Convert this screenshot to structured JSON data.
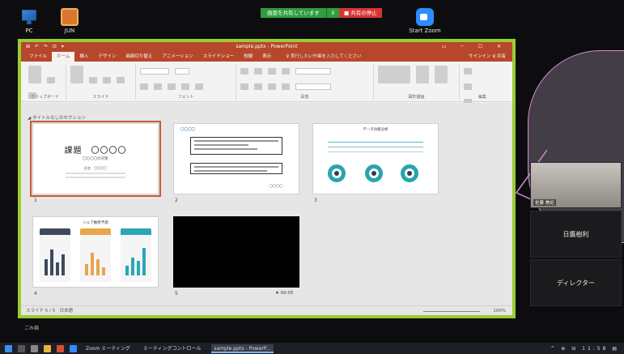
{
  "desktop": {
    "icons": [
      {
        "label": "PC"
      },
      {
        "label": "JUN"
      },
      {
        "label": "Start Zoom"
      }
    ],
    "bottom_note": "ごみ箱"
  },
  "zoom_share_bar": {
    "sharing_label": "画面を共有しています",
    "pause_label": "Ⅱ",
    "stop_label": "■ 共有の停止"
  },
  "powerpoint": {
    "quick_access": "⊞ ↶ ↷ ⊡ ▾",
    "window_title": "sample.pptx - PowerPoint",
    "window_controls": "▭ ─ ☐ ✕",
    "tabs": [
      "ファイル",
      "ホーム",
      "挿入",
      "デザイン",
      "画面切り替え",
      "アニメーション",
      "スライドショー",
      "校閲",
      "表示"
    ],
    "active_tab": "ホーム",
    "tell_me": "♀ 実行したい作業を入力してください",
    "account": "サインイン  ♀ 共有",
    "ribbon_groups": [
      "クリップボード",
      "スライド",
      "フォント",
      "段落",
      "図形描画",
      "編集"
    ],
    "section_name": "◢ タイトルなしのセクション",
    "slides": [
      {
        "number": "1",
        "title": "課題　〇〇〇〇",
        "subtitle": "〇〇〇〇の対策",
        "presenter": "氏名　〇〇〇〇"
      },
      {
        "number": "2",
        "heading": "〇〇〇〇",
        "footer": "〇〇〇〇"
      },
      {
        "number": "3",
        "title": "データ比較分析"
      },
      {
        "number": "4",
        "title": "シェア推移予測"
      },
      {
        "number": "5",
        "duration": "★ 00:05"
      }
    ],
    "status_left": "スライド 5 / 5　日本語",
    "zoom_level": "100%"
  },
  "participants": {
    "video_name": "佐藤 美紀",
    "tiles": [
      "日鷹樹利",
      "ディレクター"
    ]
  },
  "taskbar": {
    "items": [
      "Zoom ミーティング",
      "ミーティングコントロール",
      "sample.pptx - PowerP..."
    ],
    "tray": "^ ⊕ ⊟ 11:58 ▤"
  }
}
